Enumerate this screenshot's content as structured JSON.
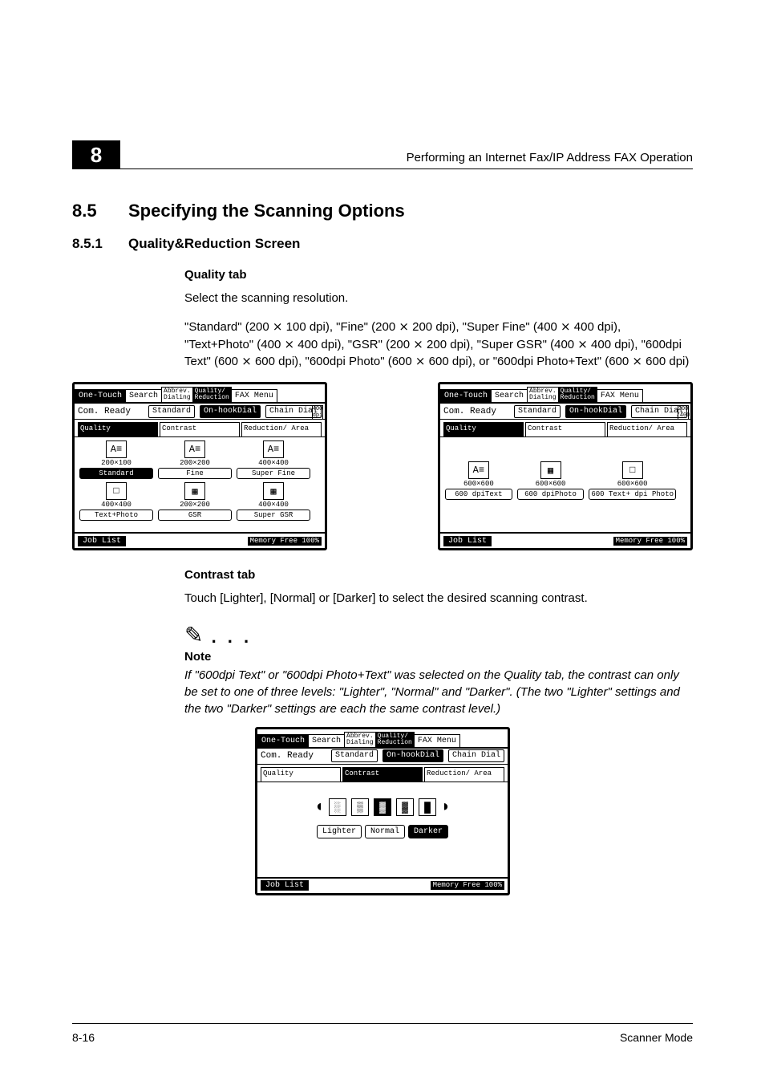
{
  "runner": {
    "right": "Performing an Internet Fax/IP Address FAX Operation"
  },
  "chapter_number": "8",
  "section": {
    "number": "8.5",
    "title": "Specifying the Scanning Options"
  },
  "subsection": {
    "number": "8.5.1",
    "title": "Quality&Reduction Screen"
  },
  "quality": {
    "heading": "Quality tab",
    "intro": "Select the scanning resolution.",
    "desc_p1": "\"Standard\" (200 ",
    "desc_p2": " 100 dpi), \"Fine\" (200 ",
    "desc_p3": " 200 dpi), \"Super Fine\" (400 ",
    "desc_p4": " 400 dpi), \"Text+Photo\" (400 ",
    "desc_p5": " 400 dpi), \"GSR\" (200 ",
    "desc_p6": " 200 dpi), \"Super GSR\" (400 ",
    "desc_p7": " 400 dpi), \"600dpi Text\" (600 ",
    "desc_p8": " 600 dpi), \"600dpi Photo\" (600 ",
    "desc_p9": " 600 dpi), or \"600dpi Photo+Text\" (600 ",
    "desc_p10": " 600 dpi)"
  },
  "times": "×",
  "screen_common": {
    "tabs": {
      "onetouch": "One-Touch",
      "search": "Search",
      "abbrev": "Abbrev.\nDialing",
      "quality": "Quality/\nReduction",
      "faxmenu": "FAX Menu"
    },
    "status": {
      "ready": "Com. Ready",
      "mode": "Standard",
      "onhook": "On-hookDial",
      "chain": "Chain Dial"
    },
    "subtabs": {
      "quality": "Quality",
      "contrast": "Contrast",
      "reduction": "Reduction/\nArea"
    },
    "footer": {
      "joblist": "Job List",
      "memory": "Memory\nFree 100%"
    },
    "scroll400": "400\ndpi",
    "scroll200": "200\n/400"
  },
  "screen1_opts": {
    "r1": [
      {
        "size": "200×100",
        "btn": "Standard",
        "sel": true,
        "ic": "A≡"
      },
      {
        "size": "200×200",
        "btn": "Fine",
        "ic": "A≡"
      },
      {
        "size": "400×400",
        "btn": "Super Fine",
        "ic": "A≡"
      }
    ],
    "r2": [
      {
        "size": "400×400",
        "btn": "Text+Photo",
        "ic": "□"
      },
      {
        "size": "200×200",
        "btn": "GSR",
        "ic": "▦"
      },
      {
        "size": "400×400",
        "btn": "Super GSR",
        "ic": "▦"
      }
    ]
  },
  "screen2_opts": {
    "r1": [
      {
        "size": "600×600",
        "btn": "600\ndpiText",
        "ic": "A≡"
      },
      {
        "size": "600×600",
        "btn": "600\ndpiPhoto",
        "ic": "▦"
      },
      {
        "size": "600×600",
        "btn": "600 Text+\ndpi    Photo",
        "ic": "□"
      }
    ]
  },
  "contrast": {
    "heading": "Contrast tab",
    "intro": "Touch [Lighter], [Normal] or [Darker] to select the desired scanning contrast."
  },
  "note": {
    "title": "Note",
    "body": "If \"600dpi Text\" or \"600dpi Photo+Text\" was selected on the Quality tab, the contrast can only be set to one of three levels: \"Lighter\", \"Normal\" and \"Darker\". (The two \"Lighter\" settings and the two \"Darker\" settings are each the same contrast level.)"
  },
  "contrast_screen": {
    "lighter": "Lighter",
    "normal": "Normal",
    "darker": "Darker"
  },
  "footer": {
    "left": "8-16",
    "right": "Scanner Mode"
  }
}
